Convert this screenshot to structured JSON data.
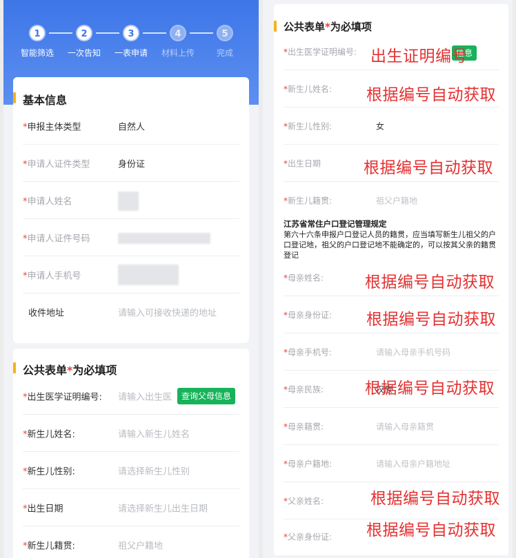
{
  "steps": [
    {
      "num": "1",
      "label": "智能筛选",
      "done": true
    },
    {
      "num": "2",
      "label": "一次告知",
      "done": true
    },
    {
      "num": "3",
      "label": "一表申请",
      "done": true
    },
    {
      "num": "4",
      "label": "材料上传",
      "done": false
    },
    {
      "num": "5",
      "label": "完成",
      "done": false
    }
  ],
  "basic": {
    "title": "基本信息",
    "rows": [
      {
        "label": "申报主体类型",
        "value": "自然人"
      },
      {
        "label": "申请人证件类型",
        "value": "身份证"
      },
      {
        "label": "申请人姓名",
        "value": ""
      },
      {
        "label": "申请人证件号码",
        "value": ""
      },
      {
        "label": "申请人手机号",
        "value": ""
      },
      {
        "label": "收件地址",
        "placeholder": "请输入可接收快递的地址"
      }
    ]
  },
  "public_form": {
    "title_prefix": "公共表单",
    "title_star": "*",
    "title_suffix": "为必填项",
    "left_rows": [
      {
        "label": "出生医学证明编号:",
        "placeholder": "请输入出生医"
      },
      {
        "label": "新生儿姓名:",
        "placeholder": "请输入新生儿姓名"
      },
      {
        "label": "新生儿性别:",
        "placeholder": "请选择新生儿性别"
      },
      {
        "label": "出生日期",
        "placeholder": "请选择新生儿出生日期"
      },
      {
        "label": "新生儿籍贯:",
        "placeholder": "祖父户籍地"
      }
    ],
    "query_button": "查询父母信息"
  },
  "right": {
    "rows_top": [
      {
        "label": "出生医学证明编号:",
        "value": ""
      },
      {
        "label": "新生儿姓名:",
        "value": ""
      },
      {
        "label": "新生儿性别:",
        "value": "女"
      },
      {
        "label": "出生日期",
        "value": ""
      },
      {
        "label": "新生儿籍贯:",
        "placeholder": "祖父户籍地"
      }
    ],
    "note_title": "江苏省常住户口登记管理规定",
    "note_body": "第六十六条申报户口登记人员的籍贯，应当填写新生儿祖父的户口登记地，祖父的户口登记地不能确定的，可以按其父亲的籍贯登记",
    "rows_bottom": [
      {
        "label": "母亲姓名:",
        "value": ""
      },
      {
        "label": "母亲身份证:",
        "value": ""
      },
      {
        "label": "母亲手机号:",
        "placeholder": "请输入母亲手机号码"
      },
      {
        "label": "母亲民族:",
        "value": "汉族"
      },
      {
        "label": "母亲籍贯:",
        "placeholder": "请输入母亲籍贯"
      },
      {
        "label": "母亲户籍地:",
        "placeholder": "请输入母亲户籍地址"
      },
      {
        "label": "父亲姓名:",
        "value": ""
      },
      {
        "label": "父亲身份证:",
        "value": ""
      }
    ],
    "button_partial": "信息"
  },
  "annotations": {
    "birth_cert": "出生证明编号",
    "auto": "根据编号自动获取"
  },
  "colors": {
    "primary": "#3e76e8",
    "accent": "#f5b21b",
    "required": "#e8413a",
    "button": "#16b35a",
    "annotation": "#e43131"
  }
}
